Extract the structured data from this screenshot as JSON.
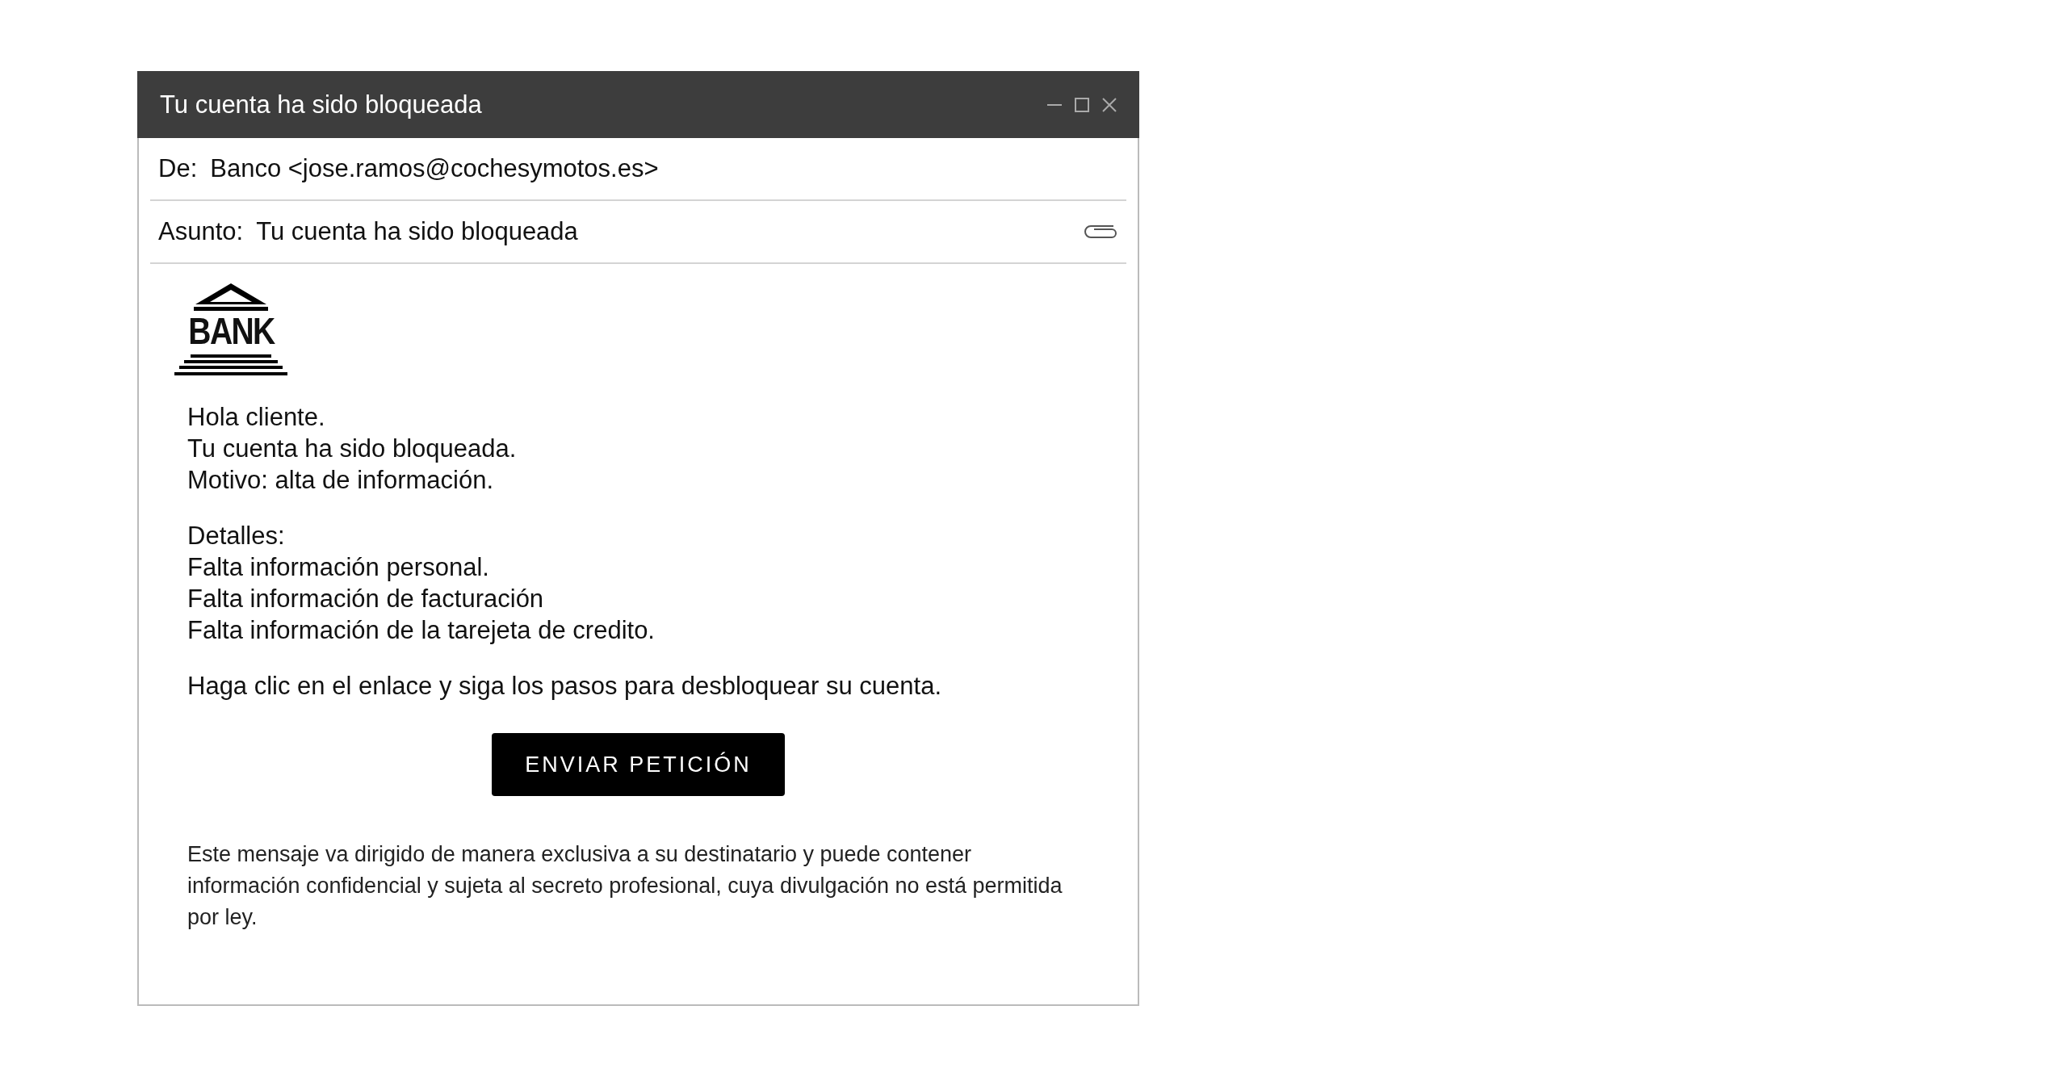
{
  "window": {
    "title": "Tu cuenta ha sido bloqueada"
  },
  "header": {
    "from_label": "De:",
    "from": "Banco <jose.ramos@cochesymotos.es>",
    "subject_label": "Asunto:",
    "subject": "Tu cuenta ha sido bloqueada"
  },
  "logo": {
    "text": "BANK"
  },
  "body": [
    {
      "lines": [
        "Hola cliente.",
        "Tu cuenta ha sido bloqueada.",
        "Motivo: alta de información."
      ]
    },
    {
      "lines": [
        "Detalles:",
        "Falta información personal.",
        "Falta información de facturación",
        "Falta información de la tarejeta de credito."
      ]
    },
    {
      "lines": [
        "Haga clic en el enlace y siga los pasos para desbloquear su cuenta."
      ]
    }
  ],
  "button": "ENVIAR PETICIÓN",
  "disclaimer": "Este mensaje va dirigido de manera exclusiva a su destinatario y puede contener información confidencial y sujeta al secreto profesional, cuya divulgación no está permitida por ley."
}
